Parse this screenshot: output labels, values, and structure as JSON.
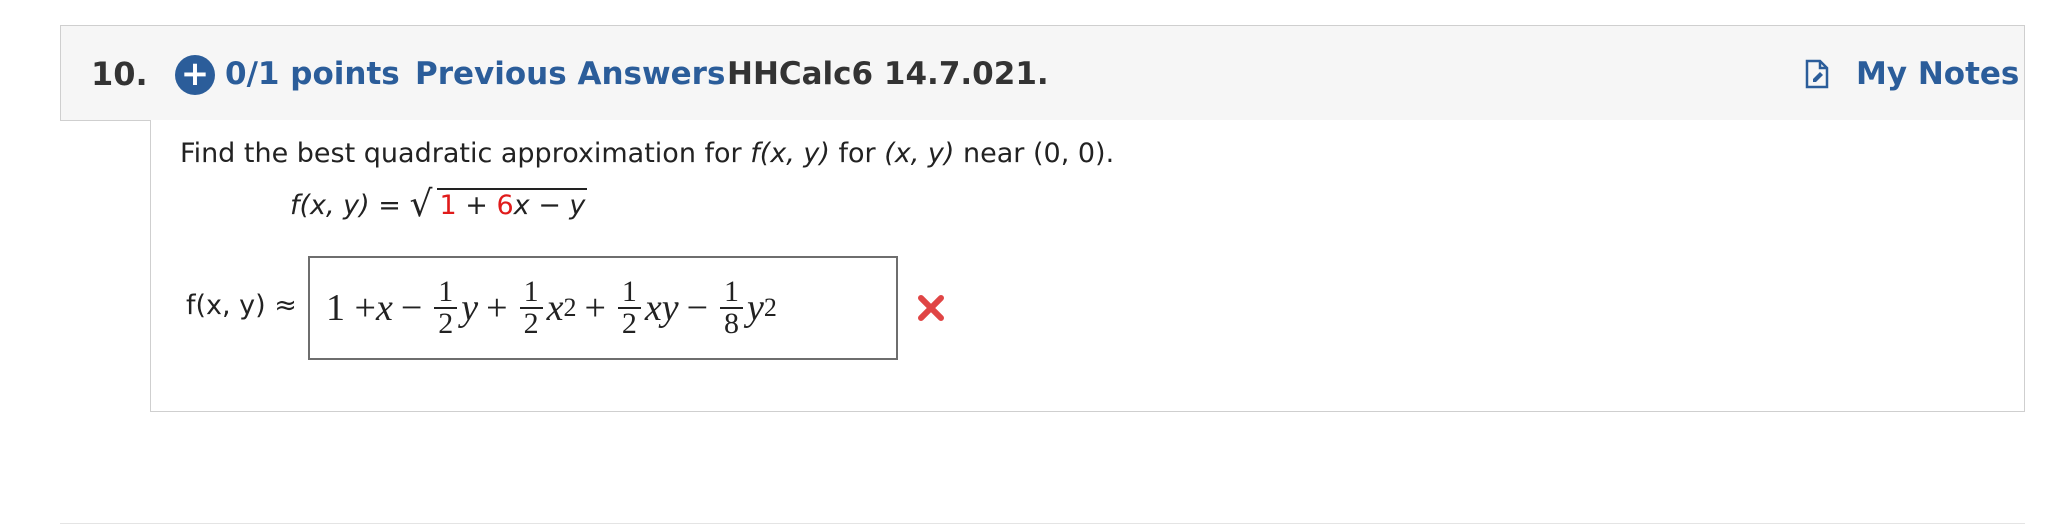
{
  "question": {
    "number": "10.",
    "points": "0/1 points",
    "previous_answers": "Previous Answers",
    "id": "HHCalc6 14.7.021.",
    "my_notes": "My Notes"
  },
  "prompt": {
    "text_a": "Find the best quadratic approximation for ",
    "fxy": "f(x, y)",
    "text_b": " for ",
    "xy": "(x, y)",
    "text_c": " near ",
    "point": "(0, 0)",
    "text_d": "."
  },
  "function": {
    "lhs": "f(x, y) = ",
    "radicand_1": "1",
    "radicand_plus": " + ",
    "radicand_6": "6",
    "radicand_rest": "x − y"
  },
  "answer": {
    "label": "f(x, y) ≈",
    "term1": "1 + ",
    "x": "x",
    "minus1": "−",
    "f1_num": "1",
    "f1_den": "2",
    "y1": "y",
    "plus2": "+",
    "f2_num": "1",
    "f2_den": "2",
    "x2": "x",
    "x2_exp": "2",
    "plus3": "+",
    "f3_num": "1",
    "f3_den": "2",
    "xy": "xy",
    "minus4": "−",
    "f4_num": "1",
    "f4_den": "8",
    "y2": "y",
    "y2_exp": "2",
    "status": "incorrect"
  },
  "colors": {
    "accent": "#2b5d9a",
    "incorrect": "#e01b1b"
  }
}
